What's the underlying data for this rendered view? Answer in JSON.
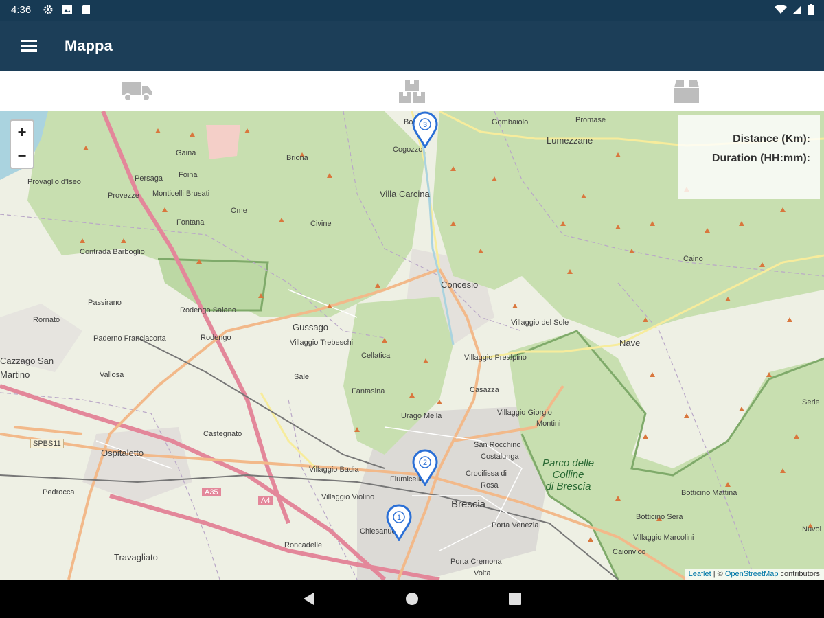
{
  "status": {
    "time": "4:36"
  },
  "app": {
    "title": "Mappa"
  },
  "tabs": [
    {
      "icon": "truck-icon"
    },
    {
      "icon": "boxes-icon"
    },
    {
      "icon": "box-icon"
    }
  ],
  "map": {
    "zoom_in": "+",
    "zoom_out": "−",
    "info": {
      "distance_label": "Distance (Km):",
      "duration_label": "Duration (HH:mm):"
    },
    "markers": [
      "1",
      "2",
      "3"
    ],
    "places": {
      "bovegno": "Bovegno",
      "gombaiolo": "Gombaiolo",
      "promase": "Promase",
      "lumezzane": "Lumezzane",
      "cogozzo": "Cogozzo",
      "gaina": "Gaina",
      "briona": "Briona",
      "persaga": "Persaga",
      "foina": "Foina",
      "provaglio": "Provaglio d'Iseo",
      "provezze": "Provezze",
      "monticelli": "Monticelli Brusati",
      "ome": "Ome",
      "fontana": "Fontana",
      "villa_carcina": "Villa Carcina",
      "civine": "Civine",
      "contrada": "Contrada Barboglio",
      "concesio": "Concesio",
      "caino": "Caino",
      "passirano": "Passirano",
      "rodengo_saiano": "Rodengo Saiano",
      "gussago": "Gussago",
      "villaggio_sole": "Villaggio del Sole",
      "rodengo": "Rodengo",
      "nave": "Nave",
      "rornato": "Rornato",
      "paderno": "Paderno Franciacorta",
      "villaggio_trebeschi": "Villaggio Trebeschi",
      "cellatica": "Cellatica",
      "villaggio_prealpino": "Villaggio Prealpino",
      "cazzago": "Cazzago San",
      "martino": "Martino",
      "vallosa": "Vallosa",
      "sale": "Sale",
      "fantasina": "Fantasina",
      "casazza": "Casazza",
      "urago": "Urago Mella",
      "villaggio_giorgio": "Villaggio Giorgio",
      "montini": "Montini",
      "spbs11": "SPBS11",
      "castegnato": "Castegnato",
      "san_rocchino": "San Rocchino",
      "costalunga": "Costalunga",
      "ospitaletto": "Ospitaletto",
      "villaggio_badia": "Villaggio Badia",
      "fiumicello": "Fiumicello",
      "crocifissa": "Crocifissa di",
      "rosa": "Rosa",
      "pedrocca": "Pedrocca",
      "a35": "A35",
      "a4": "A4",
      "villaggio_violino": "Villaggio Violino",
      "brescia": "Brescia",
      "botticino_mattina": "Botticino Mattina",
      "botticino_sera": "Botticino Sera",
      "chiesanuova": "Chiesanuova",
      "porta_venezia": "Porta Venezia",
      "villaggio_marcolini": "Villaggio Marcolini",
      "roncadelle": "Roncadelle",
      "caionvico": "Caionvico",
      "travagliato": "Travagliato",
      "porta_cremona": "Porta Cremona",
      "volta": "Volta",
      "serle": "Serle",
      "nuvolera": "Nuvol"
    },
    "park": [
      "Parco delle",
      "Colline",
      "di Brescia"
    ],
    "attribution": {
      "leaflet": "Leaflet",
      "sep": " | © ",
      "osm": "OpenStreetMap",
      "suffix": " contributors"
    }
  },
  "colors": {
    "status_bar": "#173a54",
    "app_bar": "#1c3e58",
    "marker": "#2a6fd6",
    "forest": "#c8dfb0",
    "major_road": "#e3879a",
    "road": "#f2b98a"
  }
}
